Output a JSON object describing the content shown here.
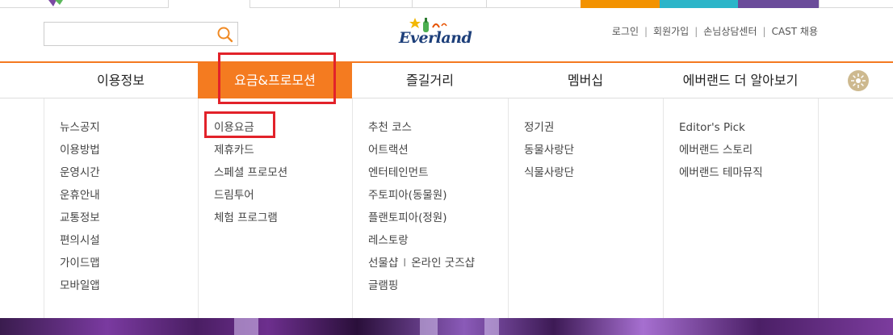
{
  "brand": {
    "logo_text": "Everland"
  },
  "search": {
    "placeholder": "",
    "value": ""
  },
  "toplinks": [
    "로그인",
    "회원가입",
    "손님상담센터",
    "CAST 채용"
  ],
  "gnb": {
    "items": [
      "이용정보",
      "요금&프로모션",
      "즐길거리",
      "멤버십",
      "에버랜드 더 알아보기"
    ],
    "active_index": 1
  },
  "menu": {
    "col1": [
      "뉴스공지",
      "이용방법",
      "운영시간",
      "운휴안내",
      "교통정보",
      "편의시설",
      "가이드맵",
      "모바일앱"
    ],
    "col2": [
      "이용요금",
      "제휴카드",
      "스페셜 프로모션",
      "드림투어",
      "체험 프로그램"
    ],
    "col3": [
      "추천 코스",
      "어트랙션",
      "엔터테인먼트",
      "주토피아(동물원)",
      "플랜토피아(정원)",
      "레스토랑"
    ],
    "col3_shop": {
      "left": "선물샵",
      "separator": "I",
      "right": "온라인 굿즈샵"
    },
    "col3_last": "글램핑",
    "col4": [
      "정기권",
      "동물사랑단",
      "식물사랑단"
    ],
    "col5": [
      "Editor's Pick",
      "에버랜드 스토리",
      "에버랜드 테마뮤직"
    ]
  },
  "colors": {
    "accent": "#f47b20",
    "highlight": "#e2222a",
    "tab_cyan": "#2cb5c9",
    "tab_purple": "#6b4c9a"
  }
}
